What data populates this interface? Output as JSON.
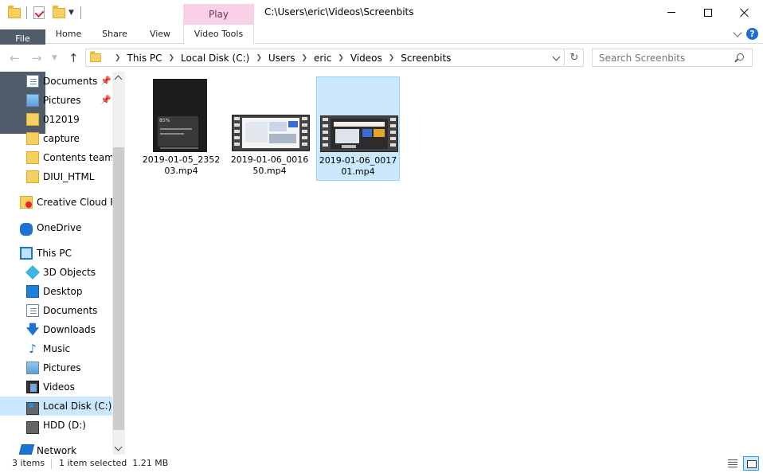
{
  "window": {
    "title": "C:\\Users\\eric\\Videos\\Screenbits",
    "context_tab_header": "Play"
  },
  "ribbon": {
    "tabs": [
      "File",
      "Home",
      "Share",
      "View",
      "Video Tools"
    ]
  },
  "address": {
    "crumbs": [
      "This PC",
      "Local Disk (C:)",
      "Users",
      "eric",
      "Videos",
      "Screenbits"
    ],
    "search_placeholder": "Search Screenbits"
  },
  "sidebar": {
    "quick_access": [
      {
        "label": "Documents",
        "icon": "documents-icon",
        "pinned": true
      },
      {
        "label": "Pictures",
        "icon": "pictures-icon",
        "pinned": true
      },
      {
        "label": "012019",
        "icon": "folder-icon",
        "pinned": false
      },
      {
        "label": "capture",
        "icon": "folder-icon",
        "pinned": false
      },
      {
        "label": "Contents team (",
        "icon": "folder-icon",
        "pinned": false
      },
      {
        "label": "DIUI_HTML",
        "icon": "folder-icon",
        "pinned": false
      }
    ],
    "creative_cloud": "Creative Cloud Fil",
    "onedrive": "OneDrive",
    "this_pc": "This PC",
    "this_pc_items": [
      {
        "label": "3D Objects",
        "icon": "3d-objects-icon"
      },
      {
        "label": "Desktop",
        "icon": "desktop-icon"
      },
      {
        "label": "Documents",
        "icon": "documents-icon"
      },
      {
        "label": "Downloads",
        "icon": "downloads-icon"
      },
      {
        "label": "Music",
        "icon": "music-icon"
      },
      {
        "label": "Pictures",
        "icon": "pictures-icon"
      },
      {
        "label": "Videos",
        "icon": "videos-icon"
      },
      {
        "label": "Local Disk (C:)",
        "icon": "local-disk-icon",
        "selected": true
      },
      {
        "label": "HDD (D:)",
        "icon": "hdd-icon"
      }
    ],
    "network": "Network"
  },
  "files": [
    {
      "line1": "2019-01-05_2352",
      "line2": "03.mp4",
      "selected": false,
      "thumb": "portrait",
      "thumb_text": "85%"
    },
    {
      "line1": "2019-01-06_0016",
      "line2": "50.mp4",
      "selected": false,
      "thumb": "film-light"
    },
    {
      "line1": "2019-01-06_0017",
      "line2": "01.mp4",
      "selected": true,
      "thumb": "film-dark"
    }
  ],
  "status": {
    "count": "3 items",
    "selection": "1 item selected  1.21 MB"
  },
  "colors": {
    "selection": "#cce8ff",
    "context_tab": "#f8d1e7",
    "file_tab": "#515c6b",
    "accent": "#1e72d2"
  }
}
